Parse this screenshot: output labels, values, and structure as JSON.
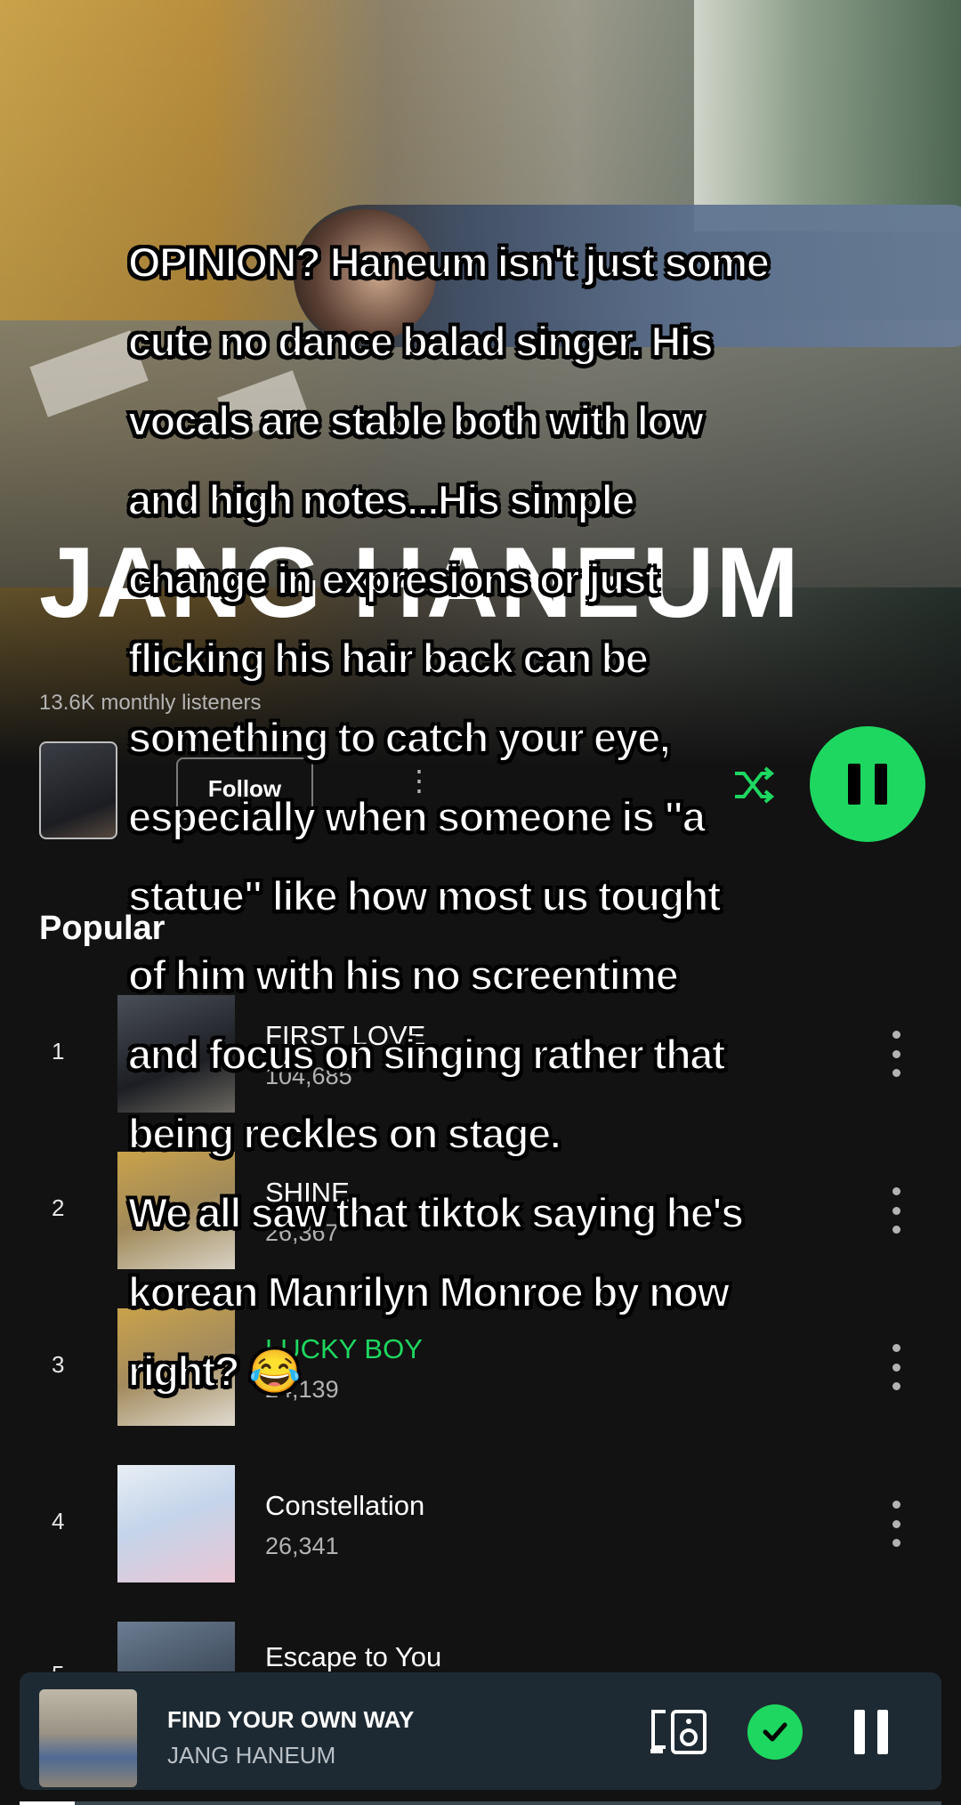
{
  "artist": {
    "name": "JANG HANEUM",
    "monthly_listeners": "13.6K monthly listeners",
    "follow_label": "Follow"
  },
  "popular": {
    "heading": "Popular",
    "tracks": [
      {
        "rank": "1",
        "title": "FIRST LOVE",
        "plays": "104,685",
        "playing": false
      },
      {
        "rank": "2",
        "title": "SHINE",
        "plays": "26,367",
        "playing": false
      },
      {
        "rank": "3",
        "title": "LUCKY BOY",
        "plays": "24,139",
        "playing": true
      },
      {
        "rank": "4",
        "title": "Constellation",
        "plays": "26,341",
        "playing": false
      },
      {
        "rank": "5",
        "title": "Escape to You",
        "plays": "",
        "playing": false
      }
    ]
  },
  "now_playing": {
    "title": "FIND YOUR OWN WAY",
    "artist": "JANG HANEUM",
    "progress": 0.06
  },
  "overlay_caption": "OPINION? Haneum isn't just some\ncute no dance balad singer. His\nvocals are stable both with low\nand high notes...His simple\nchange in expresions or just\nflicking his hair back can be\nsomething to catch your eye,\nespecially when someone is \"a\nstatue\" like how most us tought\nof him with his no screentime\nand focus on singing rather that\nbeing reckles on stage.\nWe all saw that tiktok saying he's\nkorean Manrilyn Monroe by now\nright? 😂",
  "colors": {
    "accent": "#1ed760",
    "background": "#121212",
    "mini_player": "#1e2a33"
  },
  "icons": {
    "shuffle": "shuffle-icon",
    "play_pause": "pause-icon",
    "device": "connect-device-icon",
    "saved": "check-circle-icon",
    "more": "more-vertical-icon"
  }
}
